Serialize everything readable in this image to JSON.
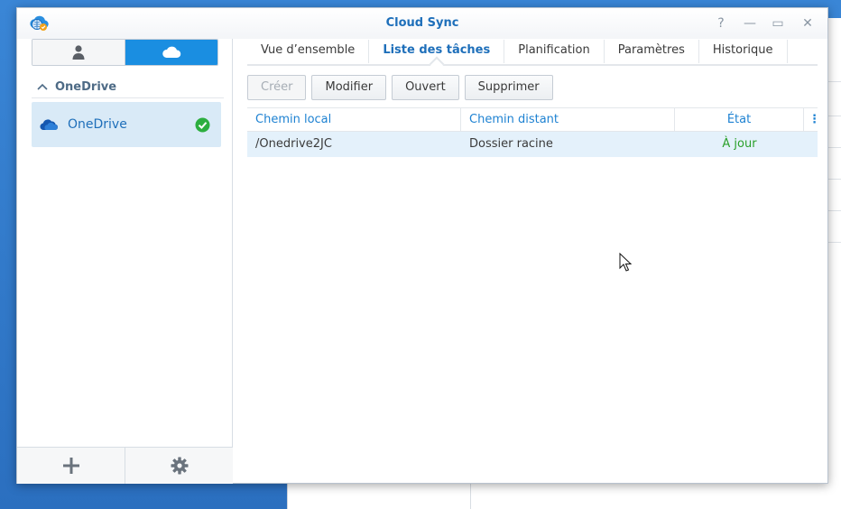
{
  "window": {
    "title": "Cloud Sync",
    "controls": {
      "help": "?",
      "minimize": "—",
      "maximize": "▭",
      "close": "✕"
    }
  },
  "sidebar": {
    "segments": [
      {
        "name": "user-icon",
        "active": false
      },
      {
        "name": "cloud-icon",
        "active": true
      }
    ],
    "group_label": "OneDrive",
    "provider": {
      "label": "OneDrive",
      "status": "ok"
    },
    "footer": [
      {
        "icon": "plus-icon"
      },
      {
        "icon": "gear-icon"
      }
    ]
  },
  "tabs": [
    {
      "label": "Vue d’ensemble",
      "active": false
    },
    {
      "label": "Liste des tâches",
      "active": true
    },
    {
      "label": "Planification",
      "active": false
    },
    {
      "label": "Paramètres",
      "active": false
    },
    {
      "label": "Historique",
      "active": false
    }
  ],
  "toolbar": {
    "create_label": "Créer",
    "create_disabled": true,
    "edit_label": "Modifier",
    "open_label": "Ouvert",
    "delete_label": "Supprimer"
  },
  "grid": {
    "columns": [
      "Chemin local",
      "Chemin distant",
      "État"
    ],
    "menu_glyph": "⋮",
    "rows": [
      {
        "local": "/Onedrive2JC",
        "remote": "Dossier racine",
        "state": "À jour"
      }
    ]
  },
  "colors": {
    "accent": "#1e6fba",
    "link": "#1e82d2",
    "status_ok": "#2aa02a",
    "selection": "#e4f1fb",
    "segment_active": "#1a8ee1"
  }
}
